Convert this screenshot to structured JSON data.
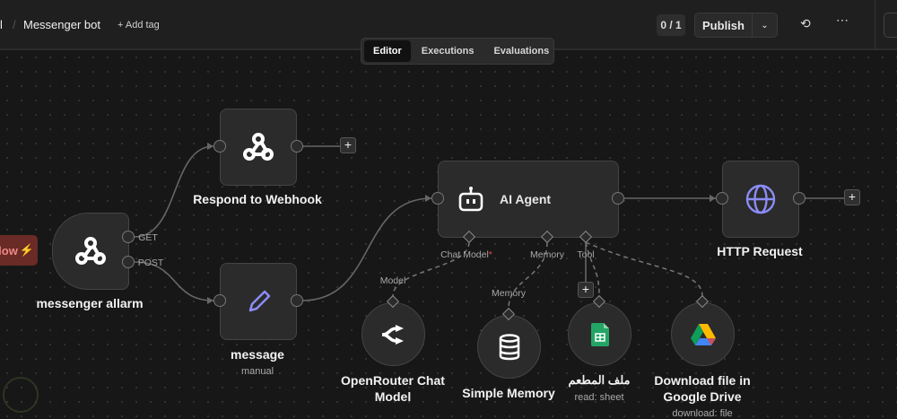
{
  "header": {
    "breadcrumb_prev": "l",
    "separator": "/",
    "workflow_name": "Messenger bot",
    "add_tag": "+ Add tag",
    "version_badge": "0 / 1",
    "publish_label": "Publish",
    "history_icon": "history-icon",
    "more_icon": "ellipsis-icon"
  },
  "tabs": [
    {
      "label": "Editor",
      "active": true
    },
    {
      "label": "Executions",
      "active": false
    },
    {
      "label": "Evaluations",
      "active": false
    }
  ],
  "trigger_pill": {
    "label": "low"
  },
  "nodes": {
    "trigger": {
      "name": "messenger allarm",
      "icon": "webhook-icon",
      "outputs": [
        "GET",
        "POST"
      ]
    },
    "respond": {
      "name": "Respond to Webhook",
      "icon": "webhook-icon"
    },
    "message": {
      "name": "message",
      "subtitle": "manual",
      "icon": "pencil-icon",
      "icon_color": "#8b8cf7"
    },
    "agent": {
      "name": "AI Agent",
      "icon": "robot-icon",
      "ports": {
        "chat_model": "Chat Model",
        "required_mark": "*",
        "memory": "Memory",
        "tool": "Tool"
      }
    },
    "http": {
      "name": "HTTP Request",
      "icon": "globe-icon",
      "icon_color": "#8b8cf7"
    },
    "openrouter": {
      "name": "OpenRouter Chat Model",
      "port_label": "Model",
      "icon": "openrouter-icon"
    },
    "memory": {
      "name": "Simple Memory",
      "port_label": "Memory",
      "icon": "database-icon"
    },
    "sheets": {
      "name": "ملف المطعم",
      "subtitle": "read: sheet",
      "icon": "google-sheets-icon"
    },
    "drive": {
      "name": "Download file in Google Drive",
      "subtitle": "download: file",
      "icon": "google-drive-icon"
    }
  },
  "colors": {
    "accent_red": "#e84a4a",
    "sheets_green": "#23a566"
  }
}
